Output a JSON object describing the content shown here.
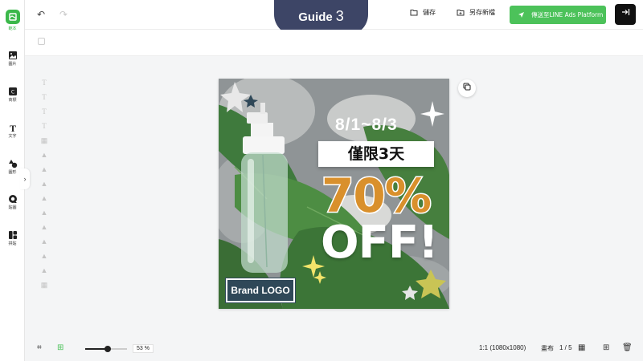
{
  "rail": {
    "items": [
      {
        "label": "範本",
        "icon": "template-icon",
        "active": true
      },
      {
        "label": "圖片",
        "icon": "image-icon"
      },
      {
        "label": "商標",
        "icon": "logo-icon"
      },
      {
        "label": "文字",
        "icon": "text-icon"
      },
      {
        "label": "圖形",
        "icon": "shapes-icon"
      },
      {
        "label": "貼圖",
        "icon": "sticker-icon"
      },
      {
        "label": "拼貼",
        "icon": "collage-icon"
      }
    ]
  },
  "header": {
    "guide_label": "Guide",
    "guide_step": "3",
    "save_label": "儲存",
    "save_as_label": "另存新檔",
    "send_label": "傳送至LINE Ads Platform",
    "accent": "#4cc25a",
    "guide_color": "#3d4566"
  },
  "design": {
    "date_range": "8/1~8/3",
    "limited_text": "僅限3天",
    "discount": "70%",
    "off_text": "OFF!",
    "brand_logo": "Brand LOGO",
    "discount_color": "#d9902c"
  },
  "footer": {
    "zoom": "53 %",
    "zoom_fraction": 0.53,
    "ratio": "1:1 (1080x1080)",
    "canvas_label": "畫布",
    "page": "1 / 5"
  }
}
